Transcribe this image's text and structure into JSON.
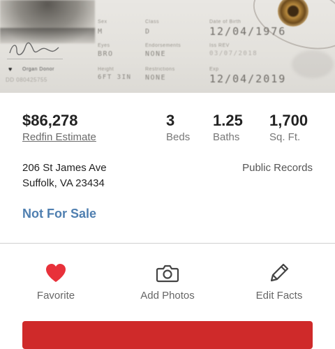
{
  "photo": {
    "card_labels": {
      "sex": "Sex",
      "class": "Class",
      "dob": "Date of Birth",
      "eyes": "Eyes",
      "endorsements": "Endorsements",
      "iss": "Iss REV",
      "height": "Height",
      "restrictions": "Restrictions",
      "exp": "Exp",
      "organ_donor": "Organ Donor"
    },
    "card_values": {
      "sex": "M",
      "class": "D",
      "dob": "12/04/1976",
      "eyes": "BRO",
      "endorsements": "NONE",
      "iss": "03/07/2018",
      "height": "6FT 3IN",
      "restrictions": "NONE",
      "exp": "12/04/2019",
      "dd": "DD 080425755"
    }
  },
  "listing": {
    "price": "$86,278",
    "estimate_label": "Redfin Estimate",
    "stats": [
      {
        "value": "3",
        "label": "Beds"
      },
      {
        "value": "1.25",
        "label": "Baths"
      },
      {
        "value": "1,700",
        "label": "Sq. Ft."
      }
    ],
    "address_line1": "206 St James Ave",
    "address_line2": "Suffolk, VA 23434",
    "source": "Public Records",
    "status": "Not For Sale"
  },
  "actions": [
    {
      "label": "Favorite",
      "icon": "heart-icon"
    },
    {
      "label": "Add Photos",
      "icon": "camera-icon"
    },
    {
      "label": "Edit Facts",
      "icon": "pencil-icon"
    }
  ],
  "colors": {
    "status_blue": "#4f7fb0",
    "favorite_red": "#e8313a",
    "cta_red": "#cf2a2a"
  }
}
